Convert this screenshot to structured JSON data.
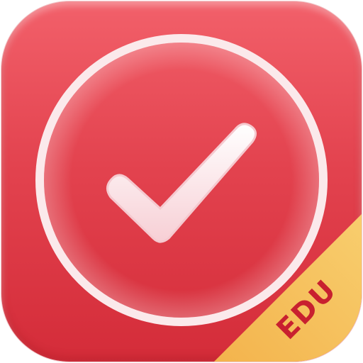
{
  "app_icon": {
    "badge_text": "EDU",
    "icon_name": "checkmark-icon",
    "colors": {
      "background_top": "#f2606a",
      "background_bottom": "#d42c39",
      "ring": "#fbe6e8",
      "check_fill": "#fde7ea",
      "ribbon": "#f6c25e",
      "badge_text": "#c8202f"
    }
  }
}
